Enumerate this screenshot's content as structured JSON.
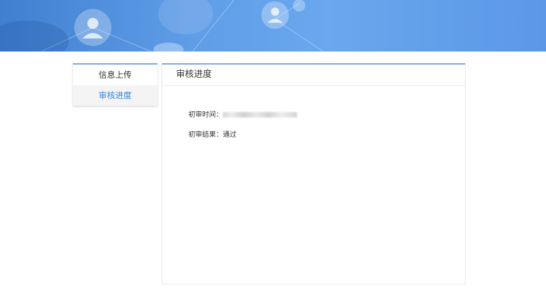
{
  "banner": {
    "colors": {
      "dark": "#3f7fcf",
      "light": "#6aa7ee"
    },
    "icons": [
      "user-avatar-icon",
      "user-avatar-icon"
    ]
  },
  "sidebar": {
    "accent_color": "#3a86e0",
    "items": [
      {
        "label": "信息上传",
        "active": false
      },
      {
        "label": "审核进度",
        "active": true
      }
    ]
  },
  "panel": {
    "title": "审核进度",
    "rows": [
      {
        "label": "初审时间：",
        "value": ""
      },
      {
        "label": "初审结果：",
        "value": "通过"
      }
    ]
  }
}
